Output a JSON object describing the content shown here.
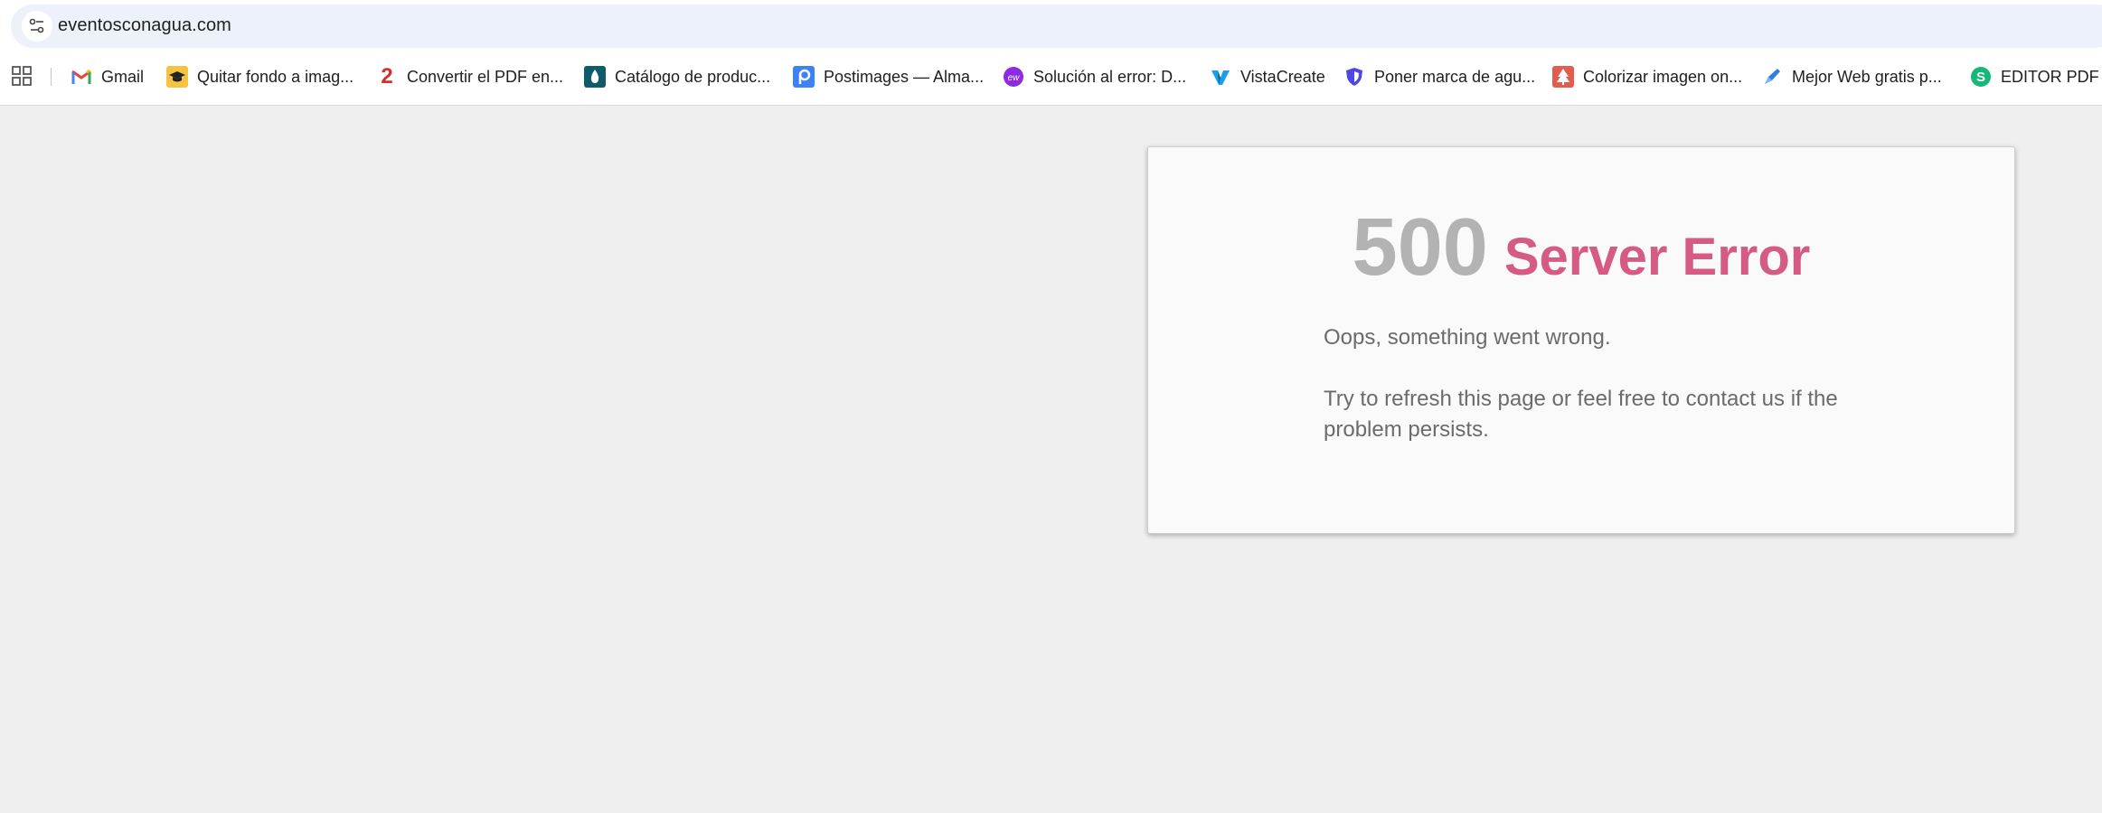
{
  "browser": {
    "url": "eventosconagua.com",
    "bookmarks": [
      {
        "label": "Gmail",
        "icon": "gmail-icon"
      },
      {
        "label": "Quitar fondo a imag...",
        "icon": "graduation-cap-icon"
      },
      {
        "label": "Convertir el PDF en...",
        "icon": "pdf-2-icon"
      },
      {
        "label": "Catálogo de produc...",
        "icon": "drop-icon"
      },
      {
        "label": "Postimages — Alma...",
        "icon": "postimages-icon"
      },
      {
        "label": "Solución al error: D...",
        "icon": "ew-icon"
      },
      {
        "label": "VistaCreate",
        "icon": "vistacreate-icon"
      },
      {
        "label": "Poner marca de agu...",
        "icon": "shield-icon"
      },
      {
        "label": "Colorizar imagen on...",
        "icon": "tree-icon"
      },
      {
        "label": "Mejor Web gratis p...",
        "icon": "pen-icon"
      },
      {
        "label": "EDITOR PDF",
        "icon": "s-icon"
      }
    ]
  },
  "error": {
    "code": "500",
    "title": "Server Error",
    "message1": "Oops, something went wrong.",
    "message2": "Try to refresh this page or feel free to contact us if the problem persists."
  },
  "colors": {
    "code": "#b3b3b3",
    "title": "#d55b85",
    "text": "#6b6b6b",
    "page_bg": "#efefef"
  }
}
